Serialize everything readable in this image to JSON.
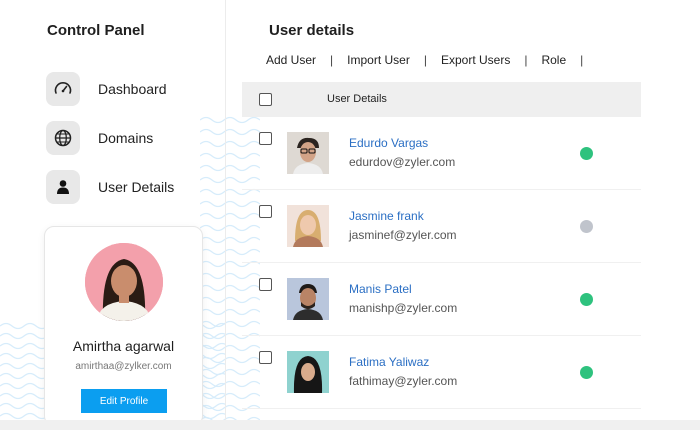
{
  "sidebar": {
    "title": "Control Panel",
    "items": [
      {
        "label": "Dashboard",
        "icon": "gauge-icon"
      },
      {
        "label": "Domains",
        "icon": "globe-icon"
      },
      {
        "label": "User Details",
        "icon": "user-icon"
      }
    ]
  },
  "profile": {
    "name": "Amirtha agarwal",
    "email": "amirthaa@zylker.com",
    "edit_label": "Edit Profile",
    "avatar_bg": "#f3a0ab"
  },
  "main": {
    "title": "User details",
    "toolbar": {
      "add": "Add User",
      "import": "Import User",
      "export": "Export Users",
      "role": "Role",
      "separator": "|"
    },
    "table": {
      "header": "User Details",
      "rows": [
        {
          "name": "Edurdo Vargas",
          "email": "edurdov@zyler.com",
          "status": "online",
          "status_color": "#2ec27e"
        },
        {
          "name": "Jasmine frank",
          "email": "jasminef@zyler.com",
          "status": "offline",
          "status_color": "#c0c4cc"
        },
        {
          "name": "Manis Patel",
          "email": "manishp@zyler.com",
          "status": "online",
          "status_color": "#2ec27e"
        },
        {
          "name": "Fatima Yaliwaz",
          "email": "fathimay@zyler.com",
          "status": "online",
          "status_color": "#2ec27e"
        }
      ]
    }
  },
  "colors": {
    "accent": "#0b9ef0",
    "link": "#2b6fc4",
    "online": "#2ec27e",
    "offline": "#c0c4cc"
  }
}
